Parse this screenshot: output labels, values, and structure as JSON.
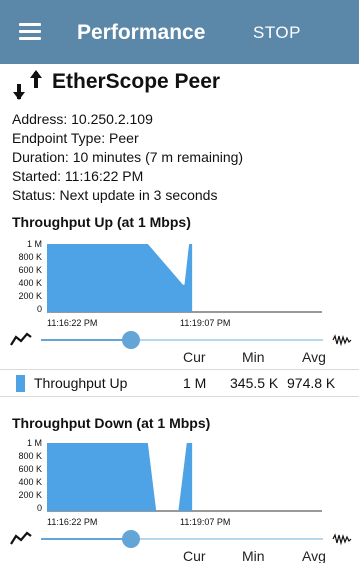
{
  "appbar": {
    "title": "Performance",
    "action": "STOP",
    "menu_icon": "hamburger-menu-icon",
    "color": "#5b87a8"
  },
  "peer": {
    "icon": "up-down-arrows-icon",
    "title": "EtherScope Peer",
    "address": "Address:  10.250.2.109",
    "endpoint_type": "Endpoint Type:  Peer",
    "duration": "Duration:  10 minutes (7 m remaining)",
    "started": "Started:  11:16:22 PM",
    "status": "Status:  Next update in 3 seconds"
  },
  "throughput_up": {
    "title": "Throughput Up (at 1 Mbps)",
    "y_ticks": [
      "1 M",
      "800 K",
      "600 K",
      "400 K",
      "200 K",
      "0"
    ],
    "x_ticks": [
      "11:16:22 PM",
      "11:19:07 PM"
    ],
    "slider": {
      "position": 0.32,
      "left_icon": "line-graph-icon",
      "right_icon": "zoom-wave-icon"
    },
    "columns": [
      "Cur",
      "Min",
      "Avg"
    ],
    "legend_label": "Throughput Up",
    "cur": "1 M",
    "min": "345.5 K",
    "avg": "974.8 K"
  },
  "throughput_down": {
    "title": "Throughput Down (at 1 Mbps)",
    "y_ticks": [
      "1 M",
      "800 K",
      "600 K",
      "400 K",
      "200 K",
      "0"
    ],
    "x_ticks": [
      "11:16:22 PM",
      "11:19:07 PM"
    ],
    "slider": {
      "position": 0.32,
      "left_icon": "line-graph-icon",
      "right_icon": "zoom-wave-icon"
    },
    "columns": [
      "Cur",
      "Min",
      "Avg"
    ]
  },
  "chart_data": [
    {
      "type": "area",
      "title": "Throughput Up (at 1 Mbps)",
      "x_unit": "seconds since 11:16:22 PM",
      "xlim": [
        0,
        360
      ],
      "ylim": [
        0,
        1000000
      ],
      "x": [
        0,
        132,
        178,
        180,
        186,
        190
      ],
      "y": [
        1000000,
        1000000,
        400000,
        400000,
        1000000,
        1000000
      ],
      "color": "#4da3e6"
    },
    {
      "type": "area",
      "title": "Throughput Down (at 1 Mbps)",
      "x_unit": "seconds since 11:16:22 PM",
      "xlim": [
        0,
        360
      ],
      "ylim": [
        0,
        1000000
      ],
      "x": [
        0,
        132,
        143,
        172,
        183,
        186,
        190
      ],
      "y": [
        1000000,
        1000000,
        0,
        0,
        1000000,
        1000000,
        1000000
      ],
      "color": "#4da3e6"
    }
  ]
}
